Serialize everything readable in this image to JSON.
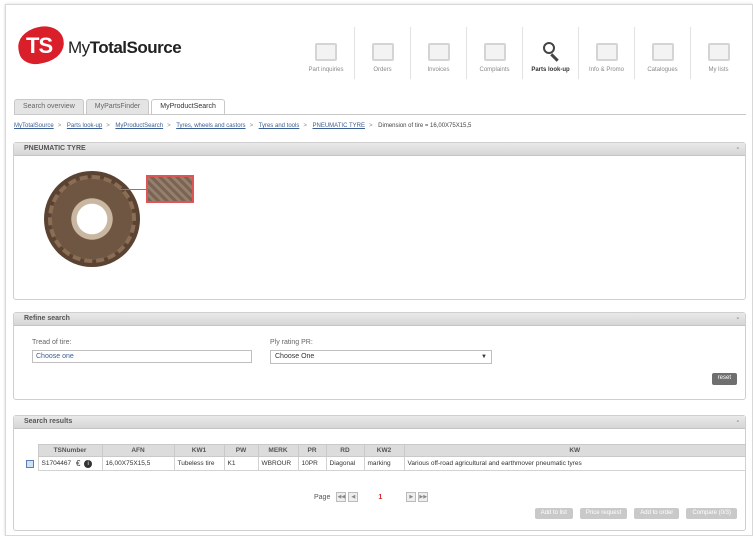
{
  "brand": {
    "mark": "TS",
    "name_prefix": "My",
    "name_mid": "Total",
    "name_suffix": "Source"
  },
  "topnav": [
    {
      "label": "Part inquiries",
      "icon": "envelope-icon"
    },
    {
      "label": "Orders",
      "icon": "folder-icon"
    },
    {
      "label": "Invoices",
      "icon": "document-icon"
    },
    {
      "label": "Complaints",
      "icon": "thumbs-down-icon"
    },
    {
      "label": "Parts look-up",
      "icon": "search-icon",
      "active": true
    },
    {
      "label": "Info & Promo",
      "icon": "chart-icon"
    },
    {
      "label": "Catalogues",
      "icon": "book-icon"
    },
    {
      "label": "My lists",
      "icon": "list-icon"
    }
  ],
  "tabs": [
    {
      "label": "Search overview"
    },
    {
      "label": "MyPartsFinder"
    },
    {
      "label": "MyProductSearch",
      "active": true
    }
  ],
  "breadcrumb": {
    "links": [
      "MyTotalSource",
      "Parts look-up",
      "MyProductSearch",
      "Tyres, wheels and castors",
      "Tyres and tools",
      "PNEUMATIC TYRE"
    ],
    "current": "Dimension of tire = 16,00X75X15,5"
  },
  "panel_tyre": {
    "title": "PNEUMATIC TYRE",
    "collapse": "-"
  },
  "panel_refine": {
    "title": "Refine search",
    "collapse": "-",
    "tread_label": "Tread of tire:",
    "tread_value": "Choose one",
    "ply_label": "Ply rating PR:",
    "ply_value": "Choose One",
    "reset_label": "reset"
  },
  "panel_results": {
    "title": "Search results",
    "collapse": "-",
    "columns": [
      "TSNumber",
      "AFN",
      "KW1",
      "PW",
      "MERK",
      "PR",
      "RD",
      "KW2",
      "KW"
    ],
    "rows": [
      {
        "tsnumber": "S1704467",
        "afn": "16,00X75X15,5",
        "kw1": "Tubeless tire",
        "pw": "K1",
        "merk": "WBROUR",
        "pr": "10PR",
        "rd": "Diagonal",
        "kw2": "marking",
        "kw": "Various off-road agricultural and earthmover pneumatic tyres"
      }
    ],
    "pager": {
      "label": "Page",
      "current": "1"
    },
    "actions": [
      "Add to list",
      "Price request",
      "Add to order",
      "Compare (0/3)"
    ]
  }
}
